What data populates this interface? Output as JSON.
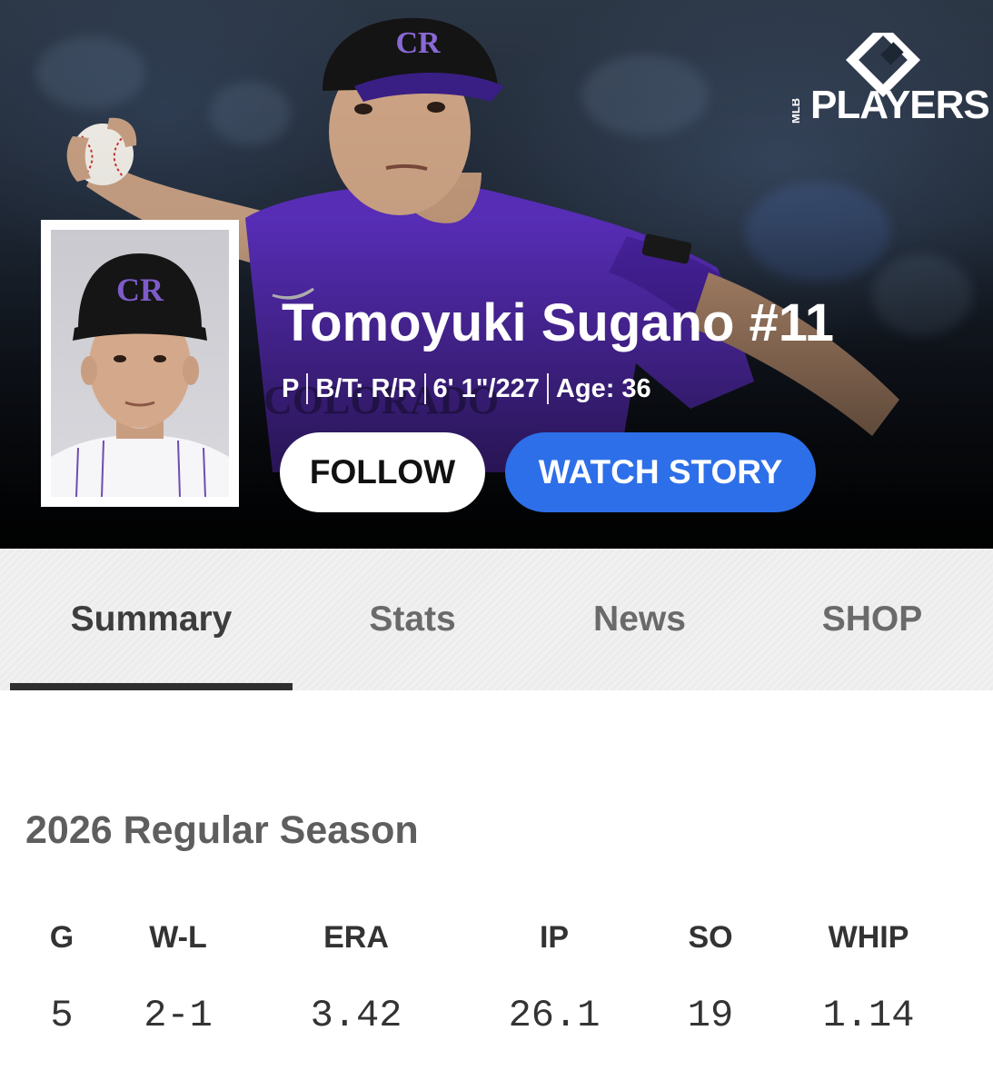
{
  "colors": {
    "hero_bg": "#1d2633",
    "jersey_purple": "#5b2fbf",
    "watch_button": "#2d6fe8",
    "tab_active_underline": "#2f2f2f",
    "text_dark": "#333333"
  },
  "brand": {
    "logo_icon": "mlb-players-diamond-icon",
    "small_text": "MLB",
    "name": "PLAYERS"
  },
  "player": {
    "name": "Tomoyuki Sugano #11",
    "bio": {
      "position": "P",
      "bats_throws": "B/T: R/R",
      "height_weight": "6' 1\"/227",
      "age": "Age: 36"
    },
    "cap_logo": "CR"
  },
  "actions": {
    "follow_label": "FOLLOW",
    "watch_label": "WATCH STORY"
  },
  "tabs": [
    {
      "label": "Summary",
      "active": true
    },
    {
      "label": "Stats",
      "active": false
    },
    {
      "label": "News",
      "active": false
    },
    {
      "label": "SHOP",
      "active": false
    }
  ],
  "season": {
    "title": "2026 Regular Season",
    "columns": [
      "G",
      "W-L",
      "ERA",
      "IP",
      "SO",
      "WHIP"
    ],
    "values": [
      "5",
      "2-1",
      "3.42",
      "26.1",
      "19",
      "1.14"
    ]
  }
}
